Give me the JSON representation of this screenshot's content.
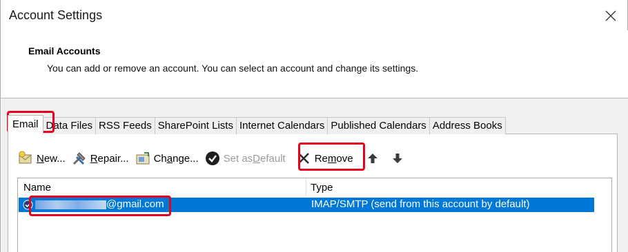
{
  "window": {
    "title": "Account Settings",
    "close_glyph": "✕"
  },
  "header": {
    "section_title": "Email Accounts",
    "description": "You can add or remove an account. You can select an account and change its settings."
  },
  "tabs": [
    {
      "label": "Email",
      "active": true
    },
    {
      "label": "Data Files"
    },
    {
      "label": "RSS Feeds"
    },
    {
      "label": "SharePoint Lists"
    },
    {
      "label": "Internet Calendars"
    },
    {
      "label": "Published Calendars"
    },
    {
      "label": "Address Books"
    }
  ],
  "toolbar": {
    "new": {
      "pre": "",
      "key": "N",
      "post": "ew..."
    },
    "repair": {
      "pre": "",
      "key": "R",
      "post": "epair..."
    },
    "change": {
      "pre": "Ch",
      "key": "a",
      "post": "nge..."
    },
    "set_default": {
      "pre": "Set as ",
      "key": "D",
      "post": "efault"
    },
    "remove": {
      "pre": "Re",
      "key": "m",
      "post": "ove"
    }
  },
  "list": {
    "columns": {
      "name": "Name",
      "type": "Type"
    },
    "rows": [
      {
        "email_visible": "@gmail.com",
        "type": "IMAP/SMTP (send from this account by default)",
        "selected": true
      }
    ]
  },
  "colors": {
    "selection": "#0078d7",
    "highlight": "#e8001c"
  }
}
